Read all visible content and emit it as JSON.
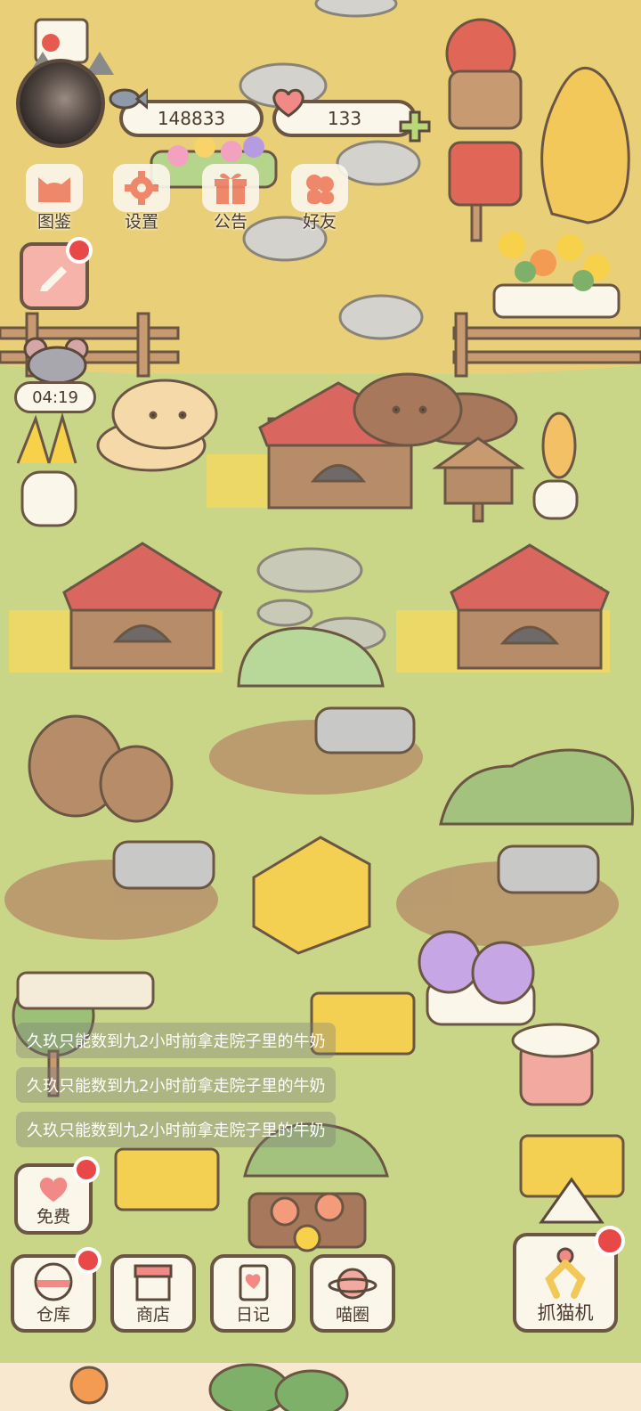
{
  "hud": {
    "currency_fish": "148833",
    "currency_hearts": "133",
    "timer": "04:19"
  },
  "top_menu": [
    {
      "label": "图鉴",
      "icon": "cat-face-icon"
    },
    {
      "label": "设置",
      "icon": "gear-icon"
    },
    {
      "label": "公告",
      "icon": "gift-icon"
    },
    {
      "label": "好友",
      "icon": "friends-icon"
    }
  ],
  "chat_messages": [
    "久玖只能数到九2小时前拿走院子里的牛奶",
    "久玖只能数到九2小时前拿走院子里的牛奶",
    "久玖只能数到九2小时前拿走院子里的牛奶"
  ],
  "bottom": {
    "free_label": "免费",
    "warehouse_label": "仓库",
    "shop_label": "商店",
    "diary_label": "日记",
    "circle_label": "喵圈",
    "claw_label": "抓猫机"
  },
  "colors": {
    "ground_top": "#e8cf78",
    "grass": "#c9d688",
    "roof_red": "#d9665f",
    "wood": "#b78d69",
    "outline": "#6b5644",
    "notification_red": "#e94848"
  }
}
